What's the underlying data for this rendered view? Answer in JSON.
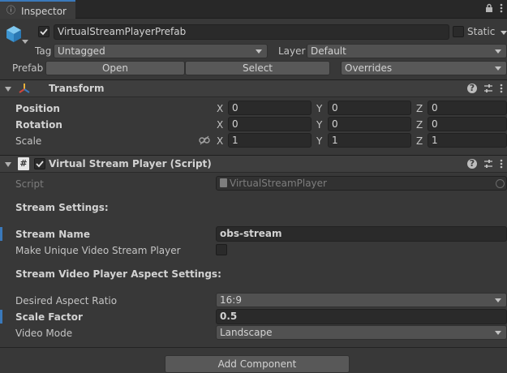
{
  "window": {
    "tab_label": "Inspector",
    "tab_icon": "info-icon",
    "lock_icon": "lock-icon",
    "menu_icon": "kebab-menu-icon"
  },
  "object": {
    "icon": "prefab-cube-icon",
    "active_checked": true,
    "name": "VirtualStreamPlayerPrefab",
    "static_label": "Static",
    "static_checked": false,
    "tag_label": "Tag",
    "tag_value": "Untagged",
    "layer_label": "Layer",
    "layer_value": "Default"
  },
  "prefab": {
    "label": "Prefab",
    "open_label": "Open",
    "select_label": "Select",
    "overrides_label": "Overrides"
  },
  "transform": {
    "title": "Transform",
    "icon": "transform-axis-icon",
    "rows": [
      {
        "label": "Position",
        "x": "0",
        "y": "0",
        "z": "0"
      },
      {
        "label": "Rotation",
        "x": "0",
        "y": "0",
        "z": "0"
      },
      {
        "label": "Scale",
        "x": "1",
        "y": "1",
        "z": "1"
      }
    ],
    "axis": {
      "x": "X",
      "y": "Y",
      "z": "Z"
    }
  },
  "script_component": {
    "title": "Virtual Stream Player (Script)",
    "icon": "script-hash-icon",
    "script_label": "Script",
    "script_value": "VirtualStreamPlayer",
    "stream_settings_header": "Stream Settings:",
    "stream_name_label": "Stream Name",
    "stream_name_value": "obs-stream",
    "unique_label": "Make Unique Video Stream Player",
    "unique_checked": false,
    "aspect_header": "Stream Video Player Aspect Settings:",
    "aspect_ratio_label": "Desired Aspect Ratio",
    "aspect_ratio_value": "16:9",
    "scale_factor_label": "Scale Factor",
    "scale_factor_value": "0.5",
    "video_mode_label": "Video Mode",
    "video_mode_value": "Landscape"
  },
  "add_component_label": "Add Component",
  "colors": {
    "accent": "#3a79bb",
    "background": "#383838",
    "field": "#2a2a2a"
  }
}
